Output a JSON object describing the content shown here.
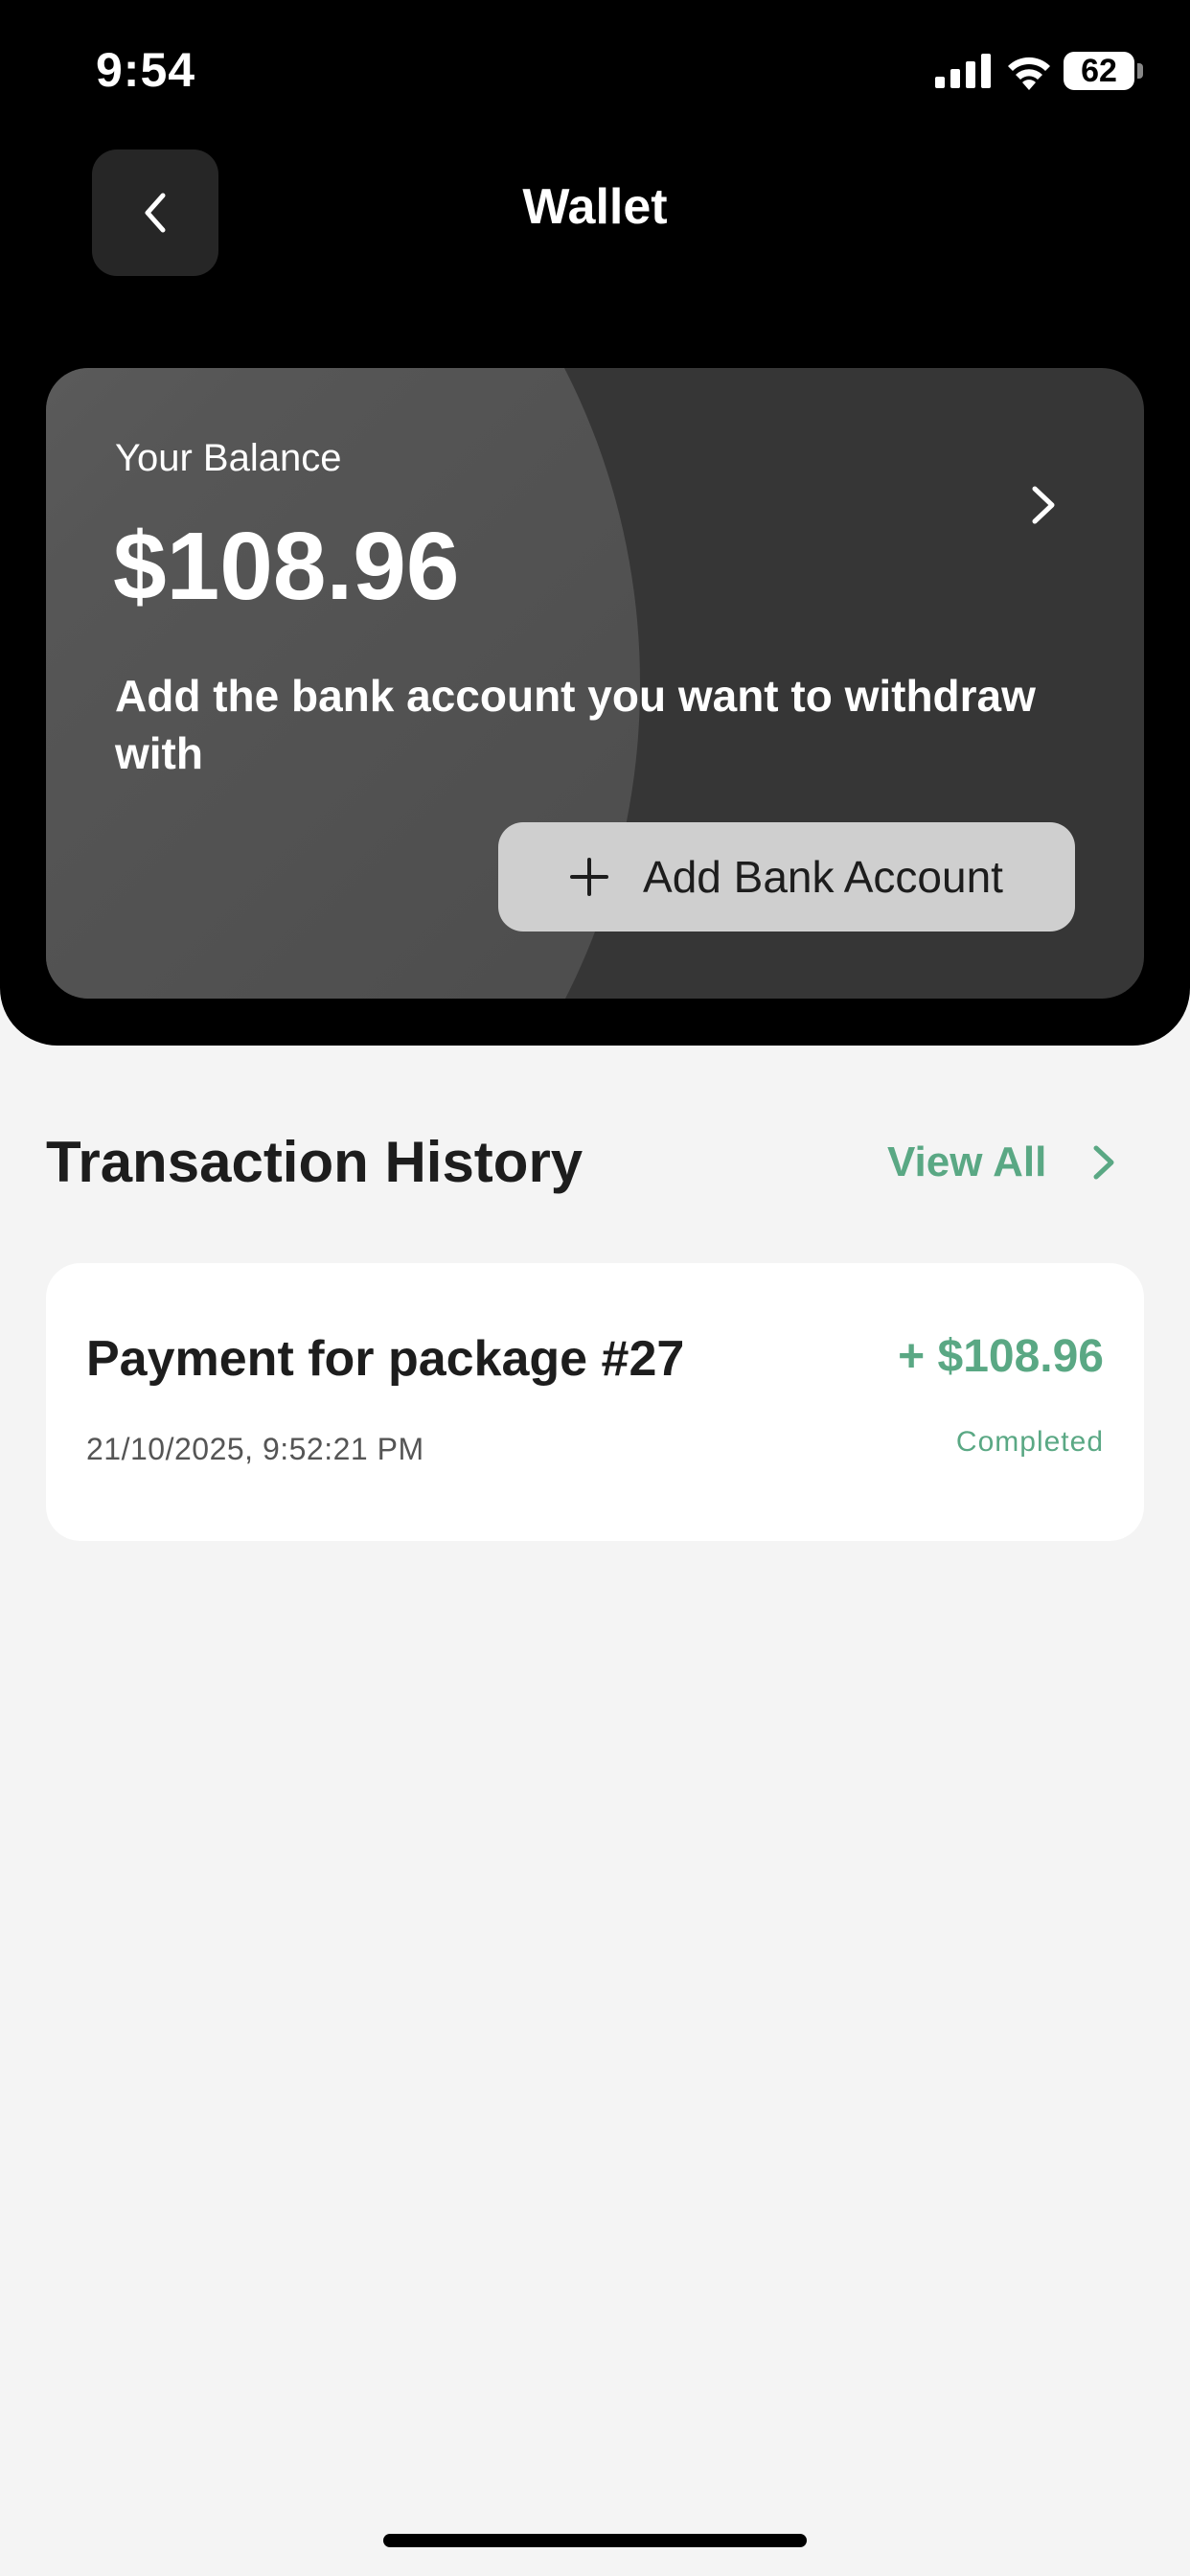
{
  "status_bar": {
    "time": "9:54",
    "battery": "62",
    "icons": [
      "signal-icon",
      "wifi-icon",
      "battery-icon"
    ]
  },
  "header": {
    "title": "Wallet",
    "back_icon": "chevron-left-icon"
  },
  "balance_card": {
    "label": "Your Balance",
    "amount": "$108.96",
    "message": "Add the bank account you want to withdraw with",
    "add_button_label": "Add Bank Account",
    "add_button_icon": "plus-icon",
    "chevron_icon": "chevron-right-icon"
  },
  "transactions": {
    "title": "Transaction History",
    "view_all_label": "View All",
    "items": [
      {
        "title": "Payment for package #27",
        "date": "21/10/2025, 9:52:21 PM",
        "amount": "+ $108.96",
        "status": "Completed"
      }
    ]
  },
  "colors": {
    "accent_green": "#5aa884",
    "header_bg": "#000000",
    "card_bg": "#363636",
    "page_bg": "#f4f4f4"
  }
}
